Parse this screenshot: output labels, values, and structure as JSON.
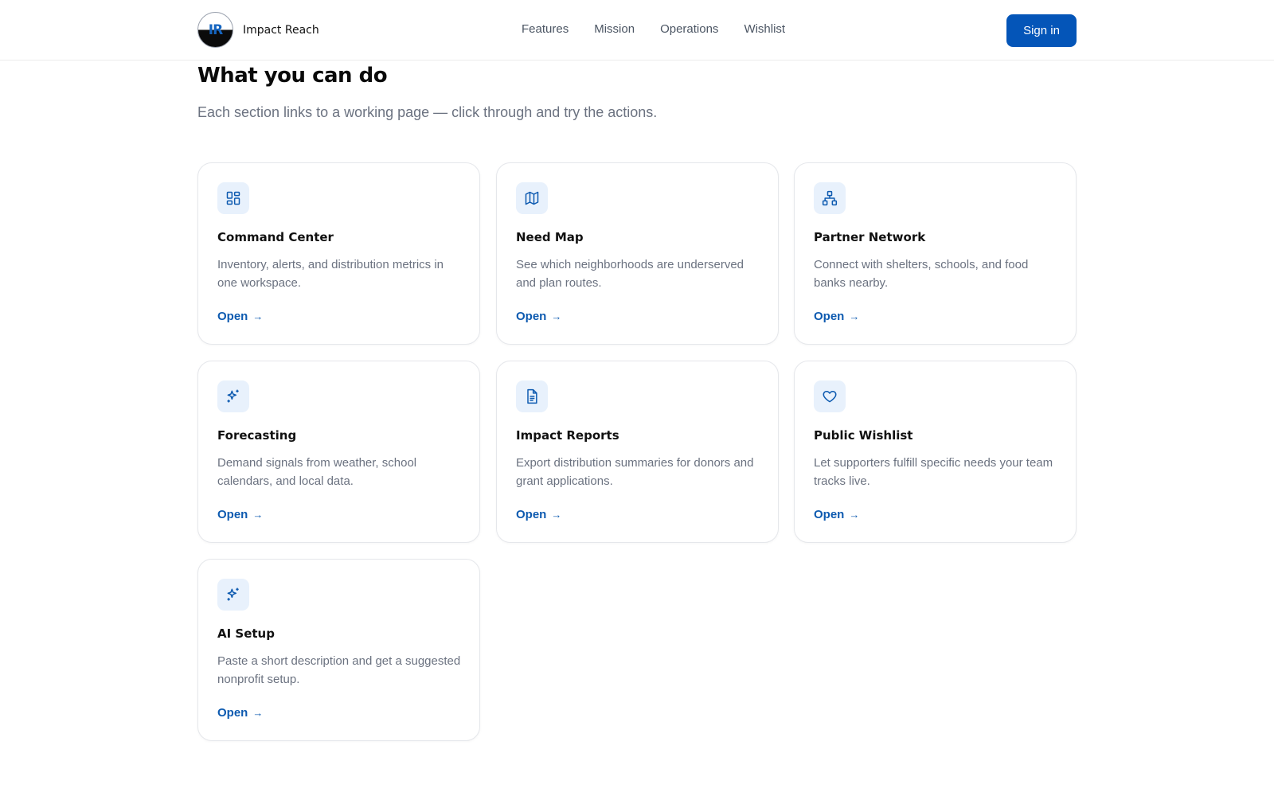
{
  "brand": {
    "logo_text": "IR",
    "name": "Impact Reach"
  },
  "nav": [
    "Features",
    "Mission",
    "Operations",
    "Wishlist"
  ],
  "signin_label": "Sign in",
  "section": {
    "title": "What you can do",
    "subtitle": "Each section links to a working page — click through and try the actions."
  },
  "cards": [
    {
      "icon": "dashboard-icon",
      "title": "Command Center",
      "description": "Inventory, alerts, and distribution metrics in one workspace.",
      "link": "Open"
    },
    {
      "icon": "map-icon",
      "title": "Need Map",
      "description": "See which neighborhoods are underserved and plan routes.",
      "link": "Open"
    },
    {
      "icon": "network-icon",
      "title": "Partner Network",
      "description": "Connect with shelters, schools, and food banks nearby.",
      "link": "Open"
    },
    {
      "icon": "sparkles-icon",
      "title": "Forecasting",
      "description": "Demand signals from weather, school calendars, and local data.",
      "link": "Open"
    },
    {
      "icon": "document-icon",
      "title": "Impact Reports",
      "description": "Export distribution summaries for donors and grant applications.",
      "link": "Open"
    },
    {
      "icon": "heart-icon",
      "title": "Public Wishlist",
      "description": "Let supporters fulfill specific needs your team tracks live.",
      "link": "Open"
    },
    {
      "icon": "sparkles-icon",
      "title": "AI Setup",
      "description": "Paste a short description and get a suggested nonprofit setup.",
      "link": "Open"
    }
  ],
  "colors": {
    "accent": "#0455b8",
    "link": "#0d5ab0",
    "icon_bg": "#e8f1fc",
    "muted_text": "#6b7280"
  }
}
